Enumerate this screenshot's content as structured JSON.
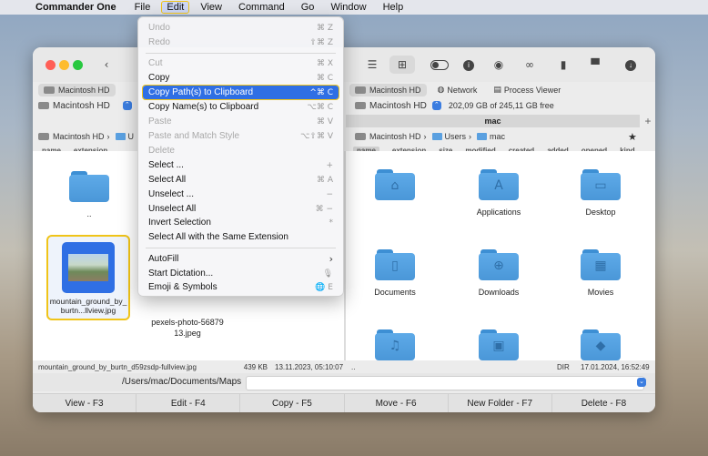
{
  "menubar": {
    "app_name": "Commander One",
    "items": [
      "File",
      "Edit",
      "View",
      "Command",
      "Go",
      "Window",
      "Help"
    ]
  },
  "left_panel": {
    "tab": "Macintosh HD",
    "volume": "Macintosh HD",
    "breadcrumb_root": "Macintosh HD",
    "breadcrumb_folder": "U",
    "columns": [
      "name",
      "extension"
    ],
    "items": [
      {
        "label": ".."
      },
      {
        "label": "mountain_ground_by_burtn...llview.jpg"
      },
      {
        "label": "pexels-photo-5687913.jpeg"
      }
    ],
    "status_file": "mountain_ground_by_burtn_d59zsdp-fullview.jpg",
    "status_size": "439 KB",
    "status_date": "13.11.2023, 05:10:07"
  },
  "right_panel": {
    "tabs": [
      "Macintosh HD",
      "Network",
      "Process Viewer"
    ],
    "volume": "Macintosh HD",
    "free_space": "202,09 GB of 245,11 GB free",
    "tab_title": "mac",
    "breadcrumb": [
      "Macintosh HD",
      "Users",
      "mac"
    ],
    "columns": [
      "name",
      "extension",
      "size",
      "modified",
      "created",
      "added",
      "opened",
      "kind"
    ],
    "items": [
      {
        "label": "",
        "icon": "home-icon"
      },
      {
        "label": "Applications",
        "icon": "applications-icon"
      },
      {
        "label": "Desktop",
        "icon": "desktop-icon"
      },
      {
        "label": "Documents",
        "icon": "document-icon"
      },
      {
        "label": "Downloads",
        "icon": "download-icon"
      },
      {
        "label": "Movies",
        "icon": "film-icon"
      },
      {
        "label": "",
        "icon": "music-icon"
      },
      {
        "label": "",
        "icon": "picture-icon"
      },
      {
        "label": "",
        "icon": "public-icon"
      }
    ],
    "status_name": "..",
    "status_type": "DIR",
    "status_date": "17.01.2024, 16:52:49"
  },
  "path": "/Users/mac/Documents/Maps",
  "function_keys": [
    "View - F3",
    "Edit - F4",
    "Copy - F5",
    "Move - F6",
    "New Folder - F7",
    "Delete - F8"
  ],
  "edit_menu": [
    {
      "label": "Undo",
      "shortcut": "⌘ Z",
      "enabled": false
    },
    {
      "label": "Redo",
      "shortcut": "⇧⌘ Z",
      "enabled": false
    },
    {
      "sep": true
    },
    {
      "label": "Cut",
      "shortcut": "⌘ X",
      "enabled": false
    },
    {
      "label": "Copy",
      "shortcut": "⌘ C",
      "enabled": true
    },
    {
      "label": "Copy Path(s) to Clipboard",
      "shortcut": "^⌘ C",
      "enabled": true,
      "highlighted": true
    },
    {
      "label": "Copy Name(s) to Clipboard",
      "shortcut": "⌥⌘ C",
      "enabled": true
    },
    {
      "label": "Paste",
      "shortcut": "⌘ V",
      "enabled": false
    },
    {
      "label": "Paste and Match Style",
      "shortcut": "⌥⇧⌘ V",
      "enabled": false
    },
    {
      "label": "Delete",
      "shortcut": "",
      "enabled": false
    },
    {
      "label": "Select ...",
      "shortcut": "+",
      "enabled": true
    },
    {
      "label": "Select All",
      "shortcut": "⌘ A",
      "enabled": true
    },
    {
      "label": "Unselect ...",
      "shortcut": "−",
      "enabled": true
    },
    {
      "label": "Unselect All",
      "shortcut": "⌘ −",
      "enabled": true
    },
    {
      "label": "Invert Selection",
      "shortcut": "*",
      "enabled": true
    },
    {
      "label": "Select All with the Same Extension",
      "shortcut": "",
      "enabled": true
    },
    {
      "sep": true
    },
    {
      "label": "AutoFill",
      "shortcut": "›",
      "enabled": true
    },
    {
      "label": "Start Dictation...",
      "shortcut": "🎙",
      "enabled": true
    },
    {
      "label": "Emoji & Symbols",
      "shortcut": "🌐 E",
      "enabled": true
    }
  ],
  "colors": {
    "accent": "#2f6fe4",
    "folder": "#4a97d8",
    "highlight_outline": "#f0c419"
  }
}
